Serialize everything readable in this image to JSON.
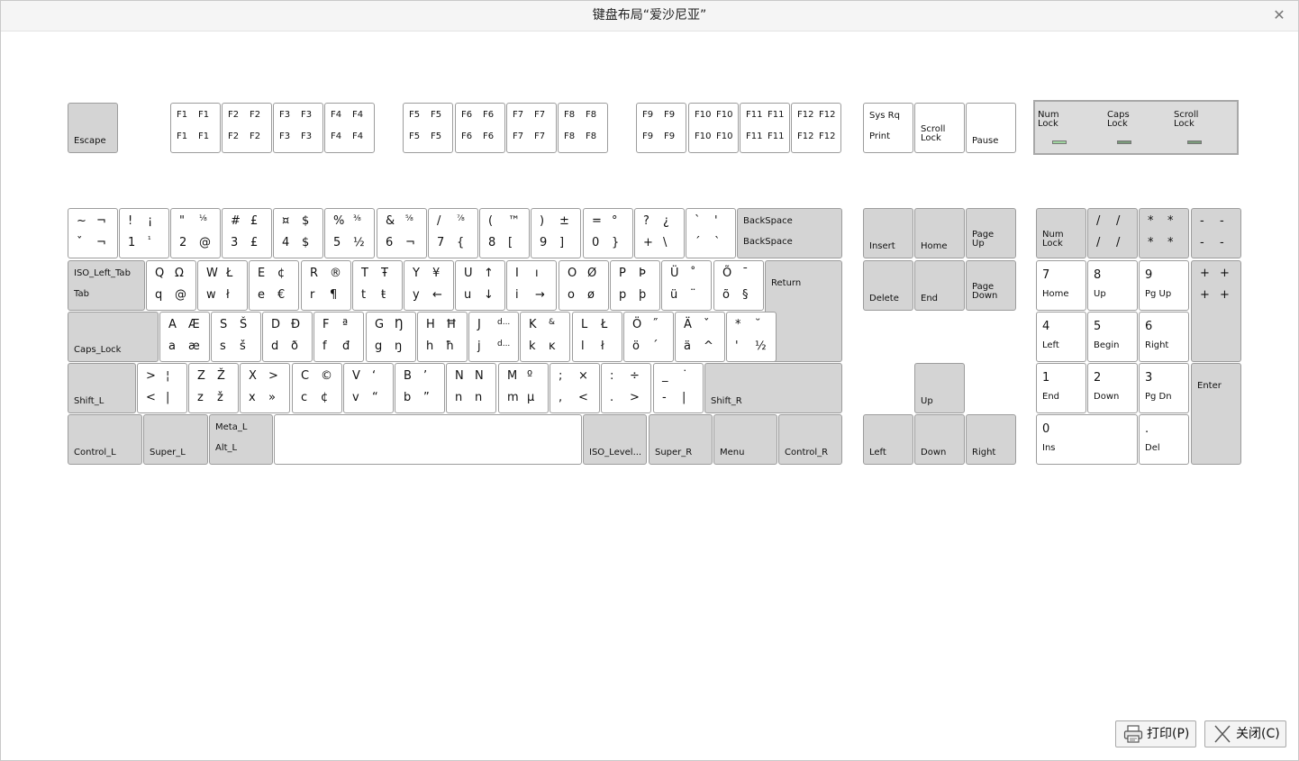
{
  "window": {
    "title": "键盘布局“爱沙尼亚”",
    "close_label": "✕"
  },
  "buttons": {
    "print_label": "打印(P)",
    "close_label": "关闭(C)"
  },
  "leds": [
    {
      "name": "Num\nLock",
      "color": "#9fd49f"
    },
    {
      "name": "Caps\nLock",
      "color": "#7a9a7a"
    },
    {
      "name": "Scroll\nLock",
      "color": "#7a9a7a"
    }
  ],
  "colors": {
    "special_key": "#d4d4d4",
    "char_key": "#ffffff",
    "border": "#9c9c9c"
  },
  "keys": {
    "function_row": [
      {
        "id": "escape",
        "name": "Escape",
        "gray": true
      },
      {
        "id": "f1",
        "fn": [
          "F1",
          "F1",
          "F1",
          "F1"
        ]
      },
      {
        "id": "f2",
        "fn": [
          "F2",
          "F2",
          "F2",
          "F2"
        ]
      },
      {
        "id": "f3",
        "fn": [
          "F3",
          "F3",
          "F3",
          "F3"
        ]
      },
      {
        "id": "f4",
        "fn": [
          "F4",
          "F4",
          "F4",
          "F4"
        ]
      },
      {
        "id": "f5",
        "fn": [
          "F5",
          "F5",
          "F5",
          "F5"
        ]
      },
      {
        "id": "f6",
        "fn": [
          "F6",
          "F6",
          "F6",
          "F6"
        ]
      },
      {
        "id": "f7",
        "fn": [
          "F7",
          "F7",
          "F7",
          "F7"
        ]
      },
      {
        "id": "f8",
        "fn": [
          "F8",
          "F8",
          "F8",
          "F8"
        ]
      },
      {
        "id": "f9",
        "fn": [
          "F9",
          "F9",
          "F9",
          "F9"
        ]
      },
      {
        "id": "f10",
        "fn": [
          "F10",
          "F10",
          "F10",
          "F10"
        ]
      },
      {
        "id": "f11",
        "fn": [
          "F11",
          "F11",
          "F11",
          "F11"
        ]
      },
      {
        "id": "f12",
        "fn": [
          "F12",
          "F12",
          "F12",
          "F12"
        ]
      },
      {
        "id": "sysrq",
        "top": "Sys Rq",
        "bottom": "Print"
      },
      {
        "id": "scroll-lock",
        "name": "Scroll\nLock"
      },
      {
        "id": "pause",
        "name": "Pause"
      }
    ],
    "number_row": [
      {
        "id": "grave",
        "c": [
          "~",
          "¬",
          "ˇ",
          "¬"
        ]
      },
      {
        "id": "1",
        "c": [
          "!",
          "¡",
          "1",
          "¹"
        ]
      },
      {
        "id": "2",
        "c": [
          "\"",
          "⅛",
          "2",
          "@"
        ]
      },
      {
        "id": "3",
        "c": [
          "#",
          "£",
          "3",
          "£"
        ]
      },
      {
        "id": "4",
        "c": [
          "¤",
          "$",
          "4",
          "$"
        ]
      },
      {
        "id": "5",
        "c": [
          "%",
          "⅜",
          "5",
          "½"
        ]
      },
      {
        "id": "6",
        "c": [
          "&",
          "⅝",
          "6",
          "¬"
        ]
      },
      {
        "id": "7",
        "c": [
          "/",
          "⅞",
          "7",
          "{"
        ]
      },
      {
        "id": "8",
        "c": [
          "(",
          "™",
          "8",
          "["
        ]
      },
      {
        "id": "9",
        "c": [
          ")",
          "±",
          "9",
          "]"
        ]
      },
      {
        "id": "0",
        "c": [
          "=",
          "°",
          "0",
          "}"
        ]
      },
      {
        "id": "minus",
        "c": [
          "?",
          "¿",
          "+",
          "\\"
        ]
      },
      {
        "id": "equal",
        "c": [
          "`",
          "'",
          "´",
          "`"
        ]
      },
      {
        "id": "backspace",
        "top": "BackSpace",
        "bottom": "BackSpace",
        "gray": true
      }
    ],
    "top_row": [
      {
        "id": "tab",
        "top": "ISO_Left_Tab",
        "bottom": "Tab",
        "gray": true
      },
      {
        "id": "q",
        "c": [
          "Q",
          "Ω",
          "q",
          "@"
        ]
      },
      {
        "id": "w",
        "c": [
          "W",
          "Ł",
          "w",
          "ł"
        ]
      },
      {
        "id": "e",
        "c": [
          "E",
          "¢",
          "e",
          "€"
        ]
      },
      {
        "id": "r",
        "c": [
          "R",
          "®",
          "r",
          "¶"
        ]
      },
      {
        "id": "t",
        "c": [
          "T",
          "Ŧ",
          "t",
          "ŧ"
        ]
      },
      {
        "id": "y",
        "c": [
          "Y",
          "¥",
          "y",
          "←"
        ]
      },
      {
        "id": "u",
        "c": [
          "U",
          "↑",
          "u",
          "↓"
        ]
      },
      {
        "id": "i",
        "c": [
          "I",
          "ı",
          "i",
          "→"
        ]
      },
      {
        "id": "o",
        "c": [
          "O",
          "Ø",
          "o",
          "ø"
        ]
      },
      {
        "id": "p",
        "c": [
          "P",
          "Þ",
          "p",
          "þ"
        ]
      },
      {
        "id": "udiaeresis",
        "c": [
          "Ü",
          "˚",
          "ü",
          "¨"
        ]
      },
      {
        "id": "otilde",
        "c": [
          "Õ",
          "¯",
          "õ",
          "§"
        ]
      },
      {
        "id": "return",
        "name": "Return",
        "gray": true
      }
    ],
    "home_row": [
      {
        "id": "caps-lock",
        "name": "Caps_Lock",
        "gray": true
      },
      {
        "id": "a",
        "c": [
          "A",
          "Æ",
          "a",
          "æ"
        ]
      },
      {
        "id": "s",
        "c": [
          "S",
          "Š",
          "s",
          "š"
        ]
      },
      {
        "id": "d",
        "c": [
          "D",
          "Đ",
          "d",
          "ð"
        ]
      },
      {
        "id": "f",
        "c": [
          "F",
          "ª",
          "f",
          "đ"
        ]
      },
      {
        "id": "g",
        "c": [
          "G",
          "Ŋ",
          "g",
          "ŋ"
        ]
      },
      {
        "id": "h",
        "c": [
          "H",
          "Ħ",
          "h",
          "ħ"
        ]
      },
      {
        "id": "j",
        "c": [
          "J",
          "d...",
          "j",
          "d..."
        ]
      },
      {
        "id": "k",
        "c": [
          "K",
          "&",
          "k",
          "ĸ"
        ]
      },
      {
        "id": "l",
        "c": [
          "L",
          "Ł",
          "l",
          "ł"
        ]
      },
      {
        "id": "odiaeresis",
        "c": [
          "Ö",
          "˝",
          "ö",
          "´"
        ]
      },
      {
        "id": "adiaeresis",
        "c": [
          "Ä",
          "ˇ",
          "ä",
          "^"
        ]
      },
      {
        "id": "apostrophe",
        "c": [
          "*",
          "˘",
          "'",
          "½"
        ]
      }
    ],
    "bottom_row": [
      {
        "id": "shift-l",
        "name": "Shift_L",
        "gray": true
      },
      {
        "id": "less",
        "c": [
          ">",
          "¦",
          "<",
          "|"
        ]
      },
      {
        "id": "z",
        "c": [
          "Z",
          "Ž",
          "z",
          "ž"
        ]
      },
      {
        "id": "x",
        "c": [
          "X",
          ">",
          "x",
          "»"
        ]
      },
      {
        "id": "c",
        "c": [
          "C",
          "©",
          "c",
          "¢"
        ]
      },
      {
        "id": "v",
        "c": [
          "V",
          "‘",
          "v",
          "“"
        ]
      },
      {
        "id": "b",
        "c": [
          "B",
          "’",
          "b",
          "”"
        ]
      },
      {
        "id": "n",
        "c": [
          "N",
          "N",
          "n",
          "n"
        ]
      },
      {
        "id": "m",
        "c": [
          "M",
          "º",
          "m",
          "µ"
        ]
      },
      {
        "id": "comma",
        "c": [
          ";",
          "×",
          ",",
          "<"
        ]
      },
      {
        "id": "period",
        "c": [
          ":",
          "÷",
          ".",
          ">"
        ]
      },
      {
        "id": "slash",
        "c": [
          "_",
          "˙",
          "-",
          "|"
        ]
      },
      {
        "id": "shift-r",
        "name": "Shift_R",
        "gray": true
      }
    ],
    "space_row": [
      {
        "id": "control-l",
        "name": "Control_L",
        "gray": true
      },
      {
        "id": "super-l",
        "name": "Super_L",
        "gray": true
      },
      {
        "id": "alt-l",
        "top": "Meta_L",
        "bottom": "Alt_L",
        "gray": true
      },
      {
        "id": "space",
        "name": ""
      },
      {
        "id": "iso-level",
        "name": "ISO_Level...",
        "gray": true
      },
      {
        "id": "super-r",
        "name": "Super_R",
        "gray": true
      },
      {
        "id": "menu",
        "name": "Menu",
        "gray": true
      },
      {
        "id": "control-r",
        "name": "Control_R",
        "gray": true
      }
    ],
    "nav": [
      {
        "id": "insert",
        "name": "Insert",
        "gray": true
      },
      {
        "id": "home",
        "name": "Home",
        "gray": true
      },
      {
        "id": "page-up",
        "name": "Page\nUp",
        "gray": true
      },
      {
        "id": "delete",
        "name": "Delete",
        "gray": true
      },
      {
        "id": "end",
        "name": "End",
        "gray": true
      },
      {
        "id": "page-down",
        "name": "Page\nDown",
        "gray": true
      },
      {
        "id": "up",
        "name": "Up",
        "gray": true
      },
      {
        "id": "left",
        "name": "Left",
        "gray": true
      },
      {
        "id": "down",
        "name": "Down",
        "gray": true
      },
      {
        "id": "right",
        "name": "Right",
        "gray": true
      }
    ],
    "numpad": [
      {
        "id": "num-lock",
        "name": "Num\nLock",
        "gray": true
      },
      {
        "id": "kp-divide",
        "c": [
          "/",
          "/",
          "/",
          "/"
        ],
        "gray": true
      },
      {
        "id": "kp-multiply",
        "c": [
          "*",
          "*",
          "*",
          "*"
        ],
        "gray": true
      },
      {
        "id": "kp-subtract",
        "c": [
          "-",
          "-",
          "-",
          "-"
        ],
        "gray": true
      },
      {
        "id": "kp-7",
        "top": "7",
        "bottom": "Home"
      },
      {
        "id": "kp-8",
        "top": "8",
        "bottom": "Up"
      },
      {
        "id": "kp-9",
        "top": "9",
        "bottom": "Pg Up"
      },
      {
        "id": "kp-add",
        "c": [
          "+",
          "+",
          "+",
          "+"
        ],
        "gray": true
      },
      {
        "id": "kp-4",
        "top": "4",
        "bottom": "Left"
      },
      {
        "id": "kp-5",
        "top": "5",
        "bottom": "Begin"
      },
      {
        "id": "kp-6",
        "top": "6",
        "bottom": "Right"
      },
      {
        "id": "kp-1",
        "top": "1",
        "bottom": "End"
      },
      {
        "id": "kp-2",
        "top": "2",
        "bottom": "Down"
      },
      {
        "id": "kp-3",
        "top": "3",
        "bottom": "Pg Dn"
      },
      {
        "id": "kp-enter",
        "name": "Enter",
        "gray": true
      },
      {
        "id": "kp-0",
        "top": "0",
        "bottom": "Ins"
      },
      {
        "id": "kp-decimal",
        "top": ".",
        "bottom": "Del"
      }
    ]
  }
}
